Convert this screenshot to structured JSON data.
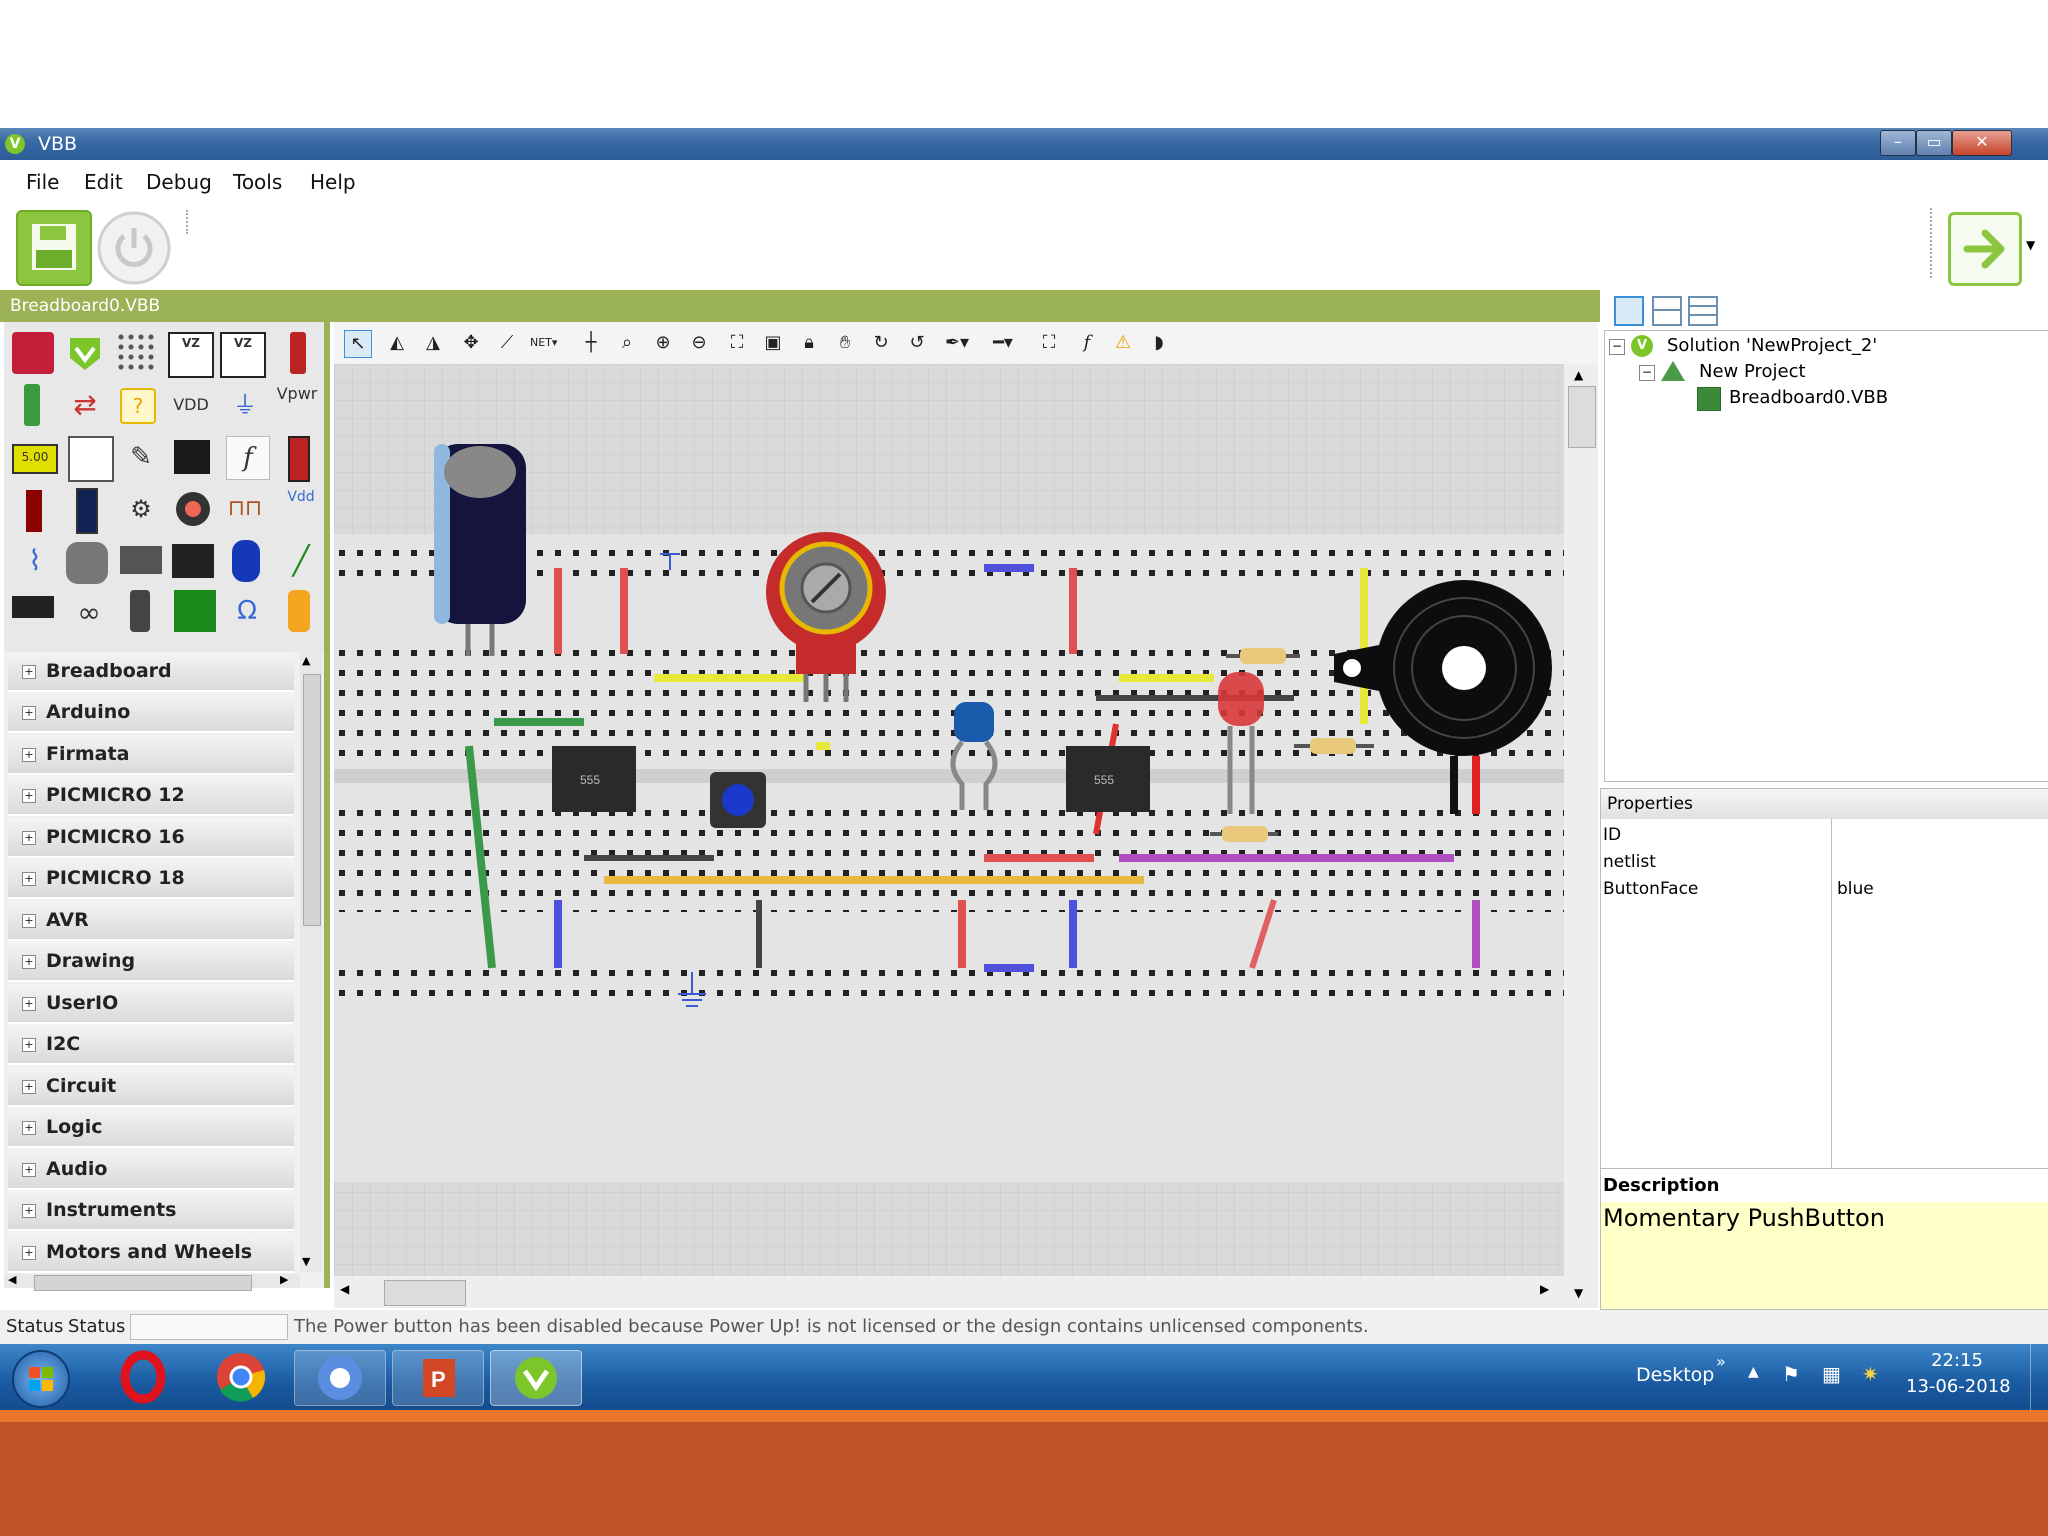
{
  "window": {
    "title": "VBB",
    "minimize": "–",
    "maximize": "▭",
    "close": "✕"
  },
  "menu": [
    "File",
    "Edit",
    "Debug",
    "Tools",
    "Help"
  ],
  "document_tab": "Breadboard0.VBB",
  "palette": {
    "row1": [
      "",
      "",
      "",
      "",
      "",
      ""
    ],
    "vdd_label": "VDD",
    "vpwr_label": "Vpwr",
    "vdd2_label": "Vdd",
    "display_label": "5.00",
    "chip_label": "555"
  },
  "categories": [
    "Breadboard",
    "Arduino",
    "Firmata",
    "PICMICRO 12",
    "PICMICRO 16",
    "PICMICRO 18",
    "AVR",
    "Drawing",
    "UserIO",
    "I2C",
    "Circuit",
    "Logic",
    "Audio",
    "Instruments",
    "Motors and Wheels"
  ],
  "tree": {
    "solution": "Solution 'NewProject_2'",
    "project": "New Project",
    "file": "Breadboard0.VBB"
  },
  "properties": {
    "title": "Properties",
    "rows": [
      {
        "name": "ID",
        "value": ""
      },
      {
        "name": "netlist",
        "value": ""
      },
      {
        "name": "ButtonFace",
        "value": "blue"
      }
    ]
  },
  "description": {
    "title": "Description",
    "text": "Momentary PushButton"
  },
  "status": {
    "label1": "Status",
    "label2": "Status",
    "message": "The Power button has been disabled because Power Up! is not licensed or the design contains unlicensed components."
  },
  "taskbar": {
    "desktop": "Desktop",
    "chevrons": "»",
    "time": "22:15",
    "date": "13-06-2018"
  },
  "colors": {
    "accent_green": "#9bb257",
    "footer": "#be5428",
    "footer_line": "#e9762b",
    "taskbar": "#1a5aa0"
  }
}
